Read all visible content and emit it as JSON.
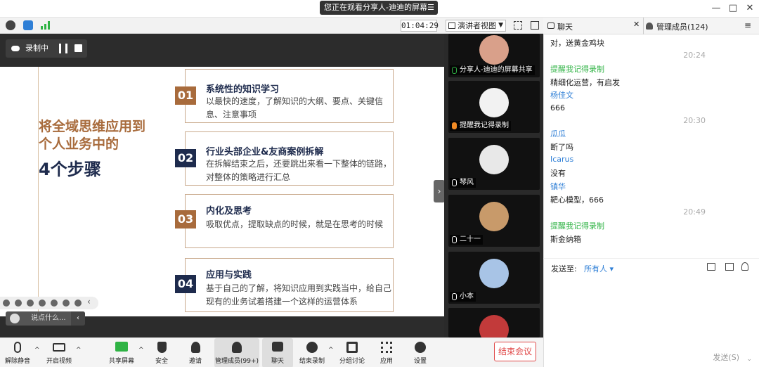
{
  "titlebar": {
    "share_banner": "您正在观看分享人-迪迪的屏幕",
    "minimize": "—",
    "maximize": "□",
    "close": "✕"
  },
  "meetbar": {
    "timer": "01:04:29",
    "view_mode": "演讲者视图"
  },
  "recording": {
    "label": "录制中"
  },
  "slide": {
    "title_line1": "将全域思维应用到",
    "title_line2": "个人业务中的",
    "title_line3": "4个步骤",
    "steps": [
      {
        "num": "01",
        "head": "系统性的知识学习",
        "body": "以最快的速度，了解知识的大纲、要点、关键信息、注意事项",
        "color": "#a86b3c"
      },
      {
        "num": "02",
        "head": "行业头部企业&友商案例拆解",
        "body": "在拆解结束之后，还要跳出来看一下整体的链路，对整体的策略进行汇总",
        "color": "#1e2b4d"
      },
      {
        "num": "03",
        "head": "内化及思考",
        "body": "吸取优点，提取缺点的时候，就是在思考的时候",
        "color": "#a86b3c"
      },
      {
        "num": "04",
        "head": "应用与实践",
        "body": "基于自己的了解，将知识应用到实践当中，给自己现有的业务试着搭建一个这样的运营体系",
        "color": "#1e2b4d"
      }
    ]
  },
  "comment": {
    "placeholder": "说点什么..."
  },
  "videos": [
    {
      "name": "分享人-迪迪的屏幕共享"
    },
    {
      "name": "提醒我记得录制"
    },
    {
      "name": "琴风"
    },
    {
      "name": "二十一"
    },
    {
      "name": "小本"
    },
    {
      "name": ""
    }
  ],
  "chat": {
    "tab_chat": "聊天",
    "tab_members": "管理成员(124)",
    "messages": [
      {
        "type": "text",
        "text": "对，送黄金鸡块"
      },
      {
        "type": "time",
        "text": "20:24"
      },
      {
        "type": "sender",
        "text": "提醒我记得录制",
        "color": "#2fb344"
      },
      {
        "type": "text",
        "text": "精细化运营，有启发"
      },
      {
        "type": "sender",
        "text": "杨佳文",
        "color": "#2f7fd6"
      },
      {
        "type": "text",
        "text": "666"
      },
      {
        "type": "time",
        "text": "20:30"
      },
      {
        "type": "sender",
        "text": "瓜瓜",
        "color": "#2f7fd6"
      },
      {
        "type": "text",
        "text": "断了吗"
      },
      {
        "type": "sender",
        "text": "Icarus",
        "color": "#2f7fd6"
      },
      {
        "type": "text",
        "text": "没有"
      },
      {
        "type": "sender",
        "text": "镇华",
        "color": "#2f7fd6"
      },
      {
        "type": "text",
        "text": "靶心模型，666"
      },
      {
        "type": "time",
        "text": "20:49"
      },
      {
        "type": "sender",
        "text": "提醒我记得录制",
        "color": "#2fb344"
      },
      {
        "type": "text",
        "text": "斯金纳箱"
      }
    ],
    "send_to_label": "发送至:",
    "send_to_value": "所有人",
    "send_button": "发送(S)"
  },
  "toolbar": {
    "unmute": "解除静音",
    "start_video": "开启视频",
    "share_screen": "共享屏幕",
    "security": "安全",
    "invite": "邀请",
    "members": "管理成员(99+)",
    "chat": "聊天",
    "stop_recording": "结束录制",
    "breakout": "分组讨论",
    "apps": "应用",
    "settings": "设置",
    "end_meeting": "结束会议"
  },
  "colors": {
    "accent_brown": "#a86b3c",
    "accent_navy": "#1e2b4d",
    "end_red": "#e04848",
    "chat_green": "#2fb344",
    "chat_blue": "#2f7fd6"
  }
}
